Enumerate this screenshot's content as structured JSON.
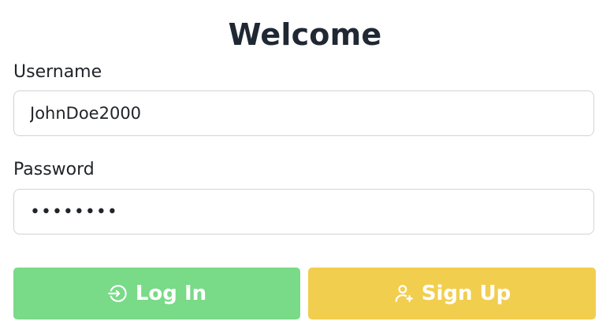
{
  "form": {
    "title": "Welcome",
    "username_label": "Username",
    "username_value": "JohnDoe2000",
    "password_label": "Password",
    "password_value": "••••••••"
  },
  "buttons": {
    "login_label": "Log In",
    "login_icon": "login-icon",
    "login_color": "#79da88",
    "signup_label": "Sign Up",
    "signup_icon": "user-plus-icon",
    "signup_color": "#f2ce4f"
  }
}
